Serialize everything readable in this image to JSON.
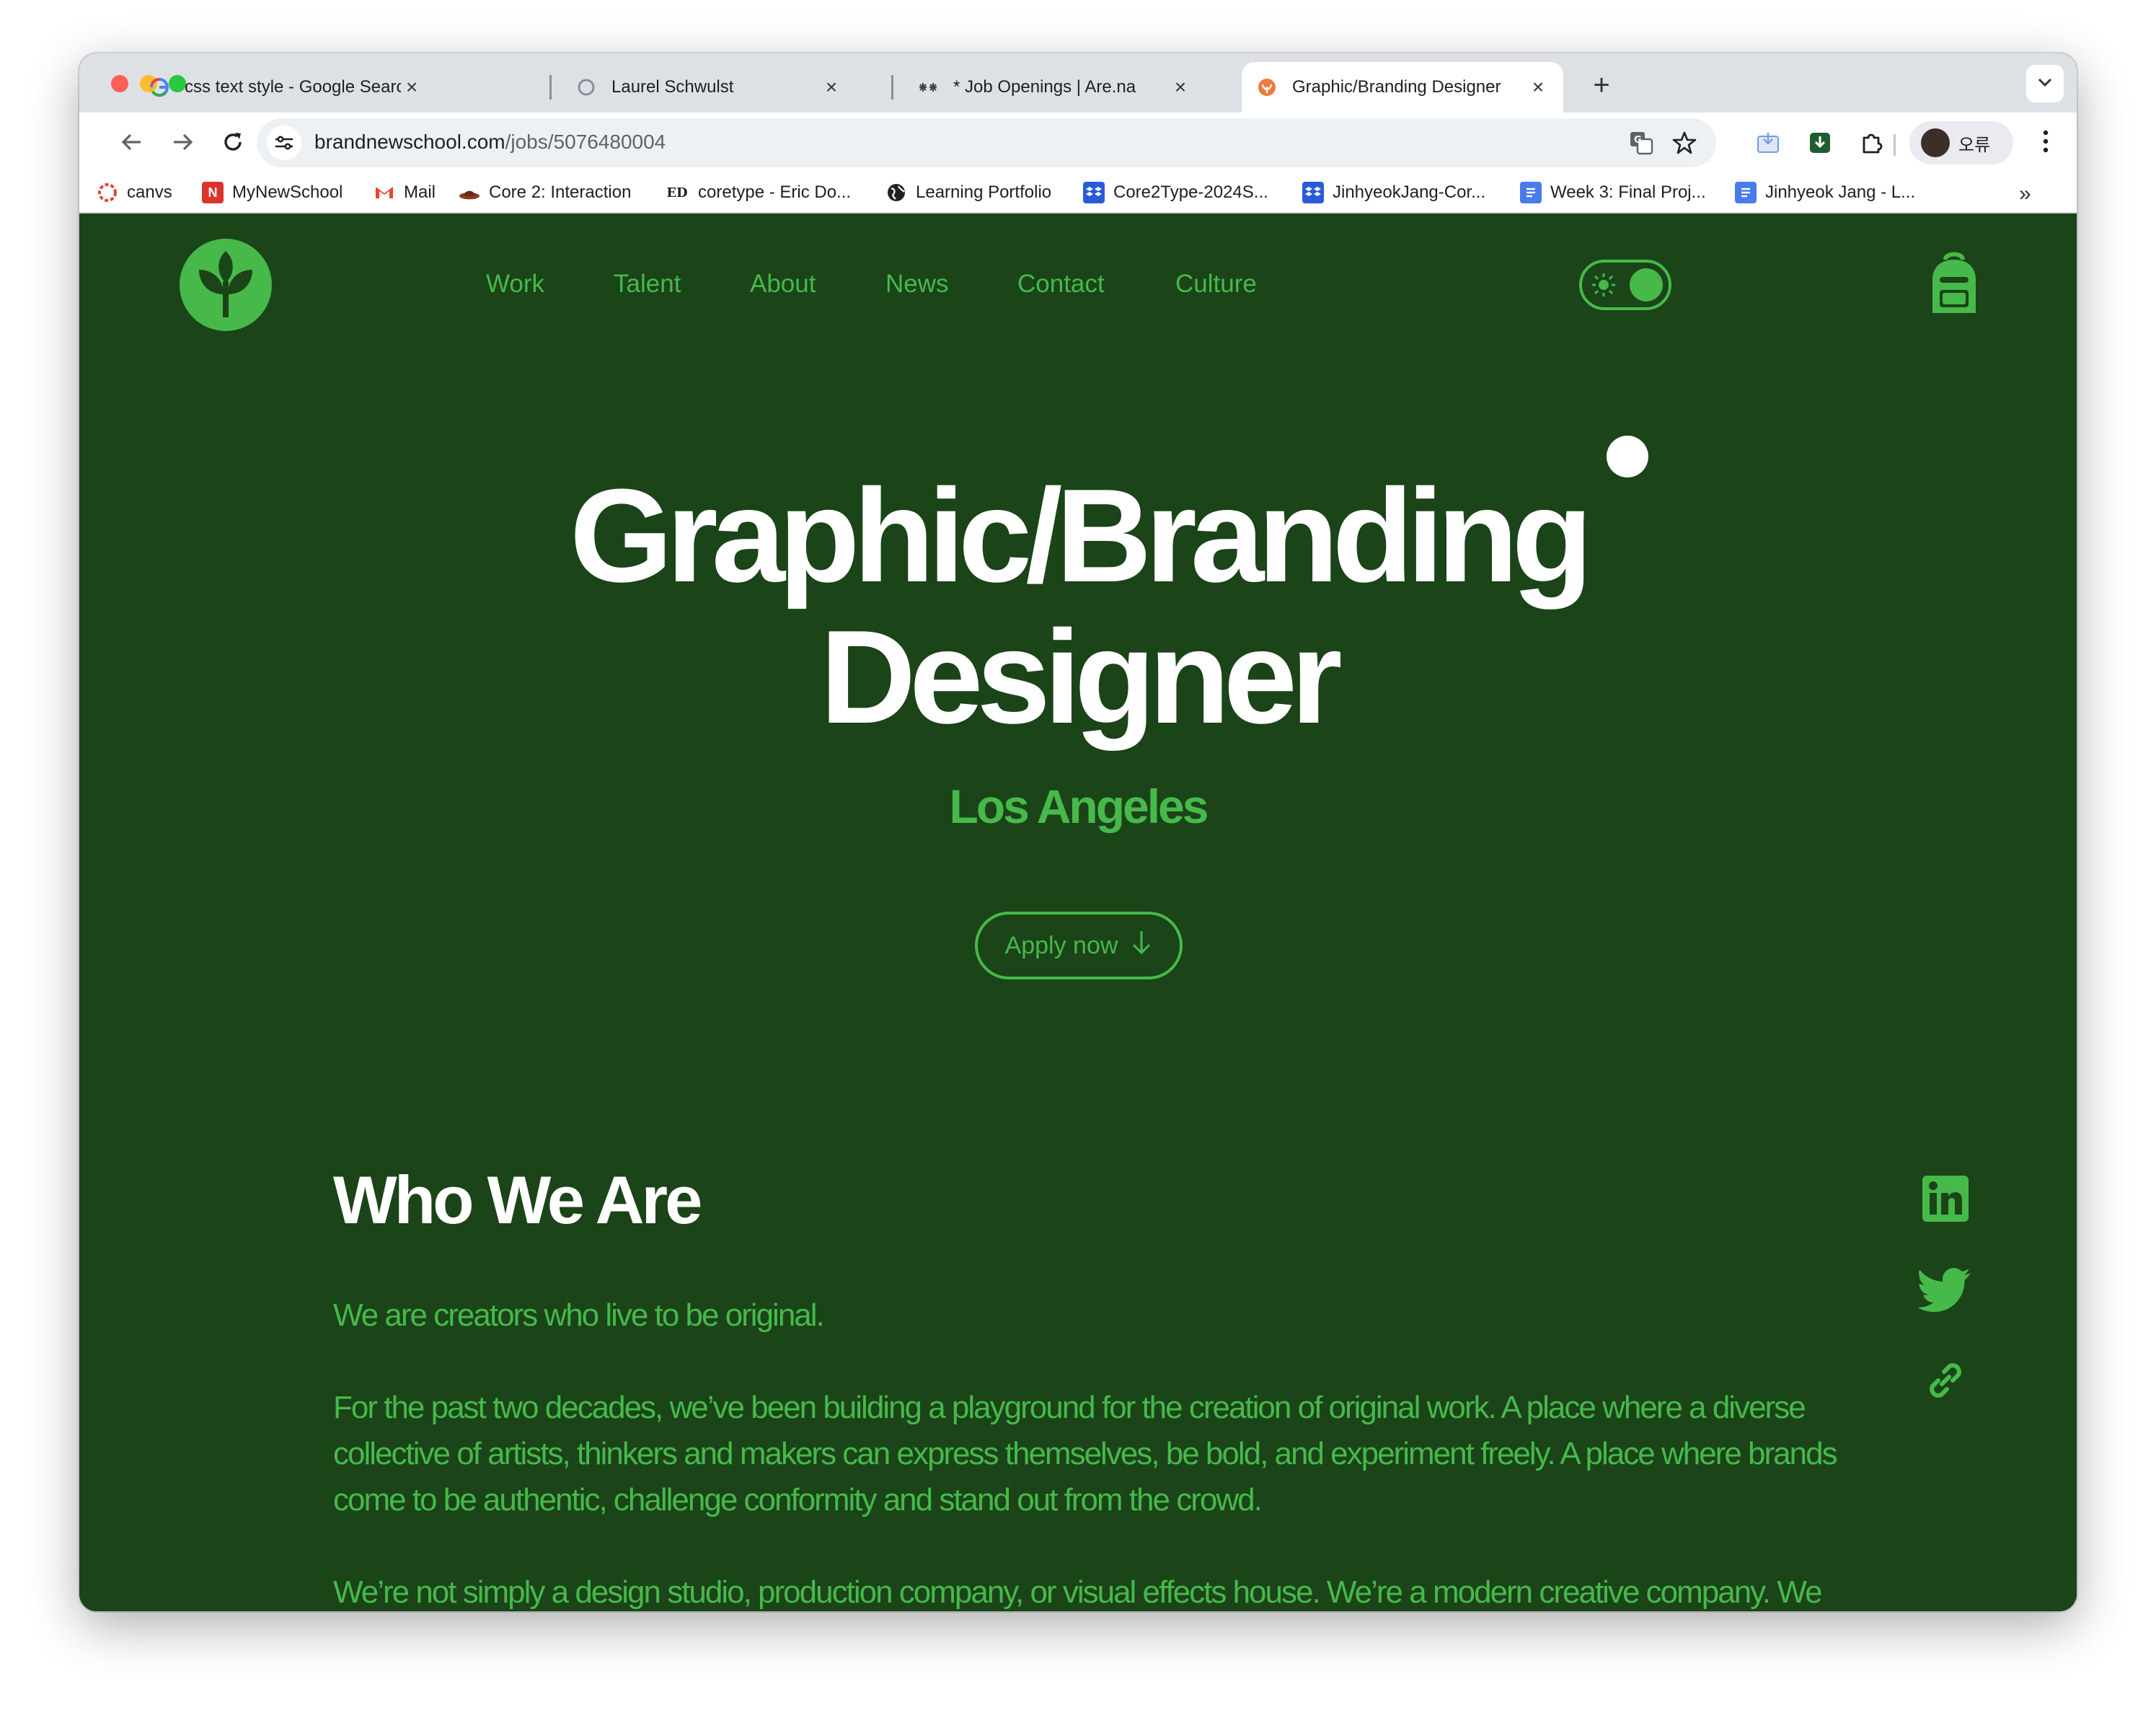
{
  "browser": {
    "tabs": [
      {
        "title": "css text style - Google Search",
        "icon": "google-icon"
      },
      {
        "title": "Laurel Schwulst",
        "icon": "globe-outline-icon"
      },
      {
        "title": "* Job Openings | Are.na",
        "icon": "arena-icon"
      },
      {
        "title": "Graphic/Branding Designer",
        "icon": "bns-favicon-icon",
        "active": true
      }
    ],
    "close_glyph": "×",
    "new_tab_glyph": "+",
    "url_domain": "brandnewschool.com",
    "url_path": "/jobs/5076480004",
    "profile_name": "오류",
    "bookmarks": [
      {
        "label": "canvs",
        "icon": "canvs-icon",
        "color": "#e0443c"
      },
      {
        "label": "MyNewSchool",
        "icon": "mynewschool-icon",
        "color": "#d9342b"
      },
      {
        "label": "Mail",
        "icon": "gmail-icon",
        "color": "#ea4335"
      },
      {
        "label": "Core 2: Interaction",
        "icon": "hat-icon",
        "color": "#8a3a22"
      },
      {
        "label": "coretype - Eric Do...",
        "icon": "ed-icon",
        "color": "#222222"
      },
      {
        "label": "Learning Portfolio",
        "icon": "globe-icon",
        "color": "#222222"
      },
      {
        "label": "Core2Type-2024S...",
        "icon": "dropbox-icon",
        "color": "#2a5bd7"
      },
      {
        "label": "JinhyeokJang-Cor...",
        "icon": "dropbox-icon",
        "color": "#2a5bd7"
      },
      {
        "label": "Week 3: Final Proj...",
        "icon": "docs-icon",
        "color": "#4a7bea"
      },
      {
        "label": "Jinhyeok Jang - L...",
        "icon": "docs-icon",
        "color": "#4a7bea"
      }
    ],
    "bookmarks_overflow": "»"
  },
  "site": {
    "nav": [
      "Work",
      "Talent",
      "About",
      "News",
      "Contact",
      "Culture"
    ],
    "theme_toggle": "on",
    "job_title_line1": "Graphic/Branding",
    "job_title_line2": "Designer",
    "location": "Los Angeles",
    "apply_label": "Apply now",
    "section_title": "Who We Are",
    "paragraphs": [
      "We are creators who live to be original.",
      "For the past two decades, we’ve been building a playground for the creation of original work. A place where a diverse collective of artists, thinkers and makers can express themselves, be bold, and experiment freely. A place where brands come to be authentic, challenge conformity and stand out from the crowd.",
      "We’re not simply a design studio, production company, or visual effects house. We’re a modern creative company. We strategize, we ideate, we design, we create, we make. We go wherever our pursuit of originality"
    ],
    "social": [
      "linkedin-icon",
      "twitter-icon",
      "link-icon"
    ]
  },
  "colors": {
    "page_bg": "#1b4419",
    "accent_green": "#46b94a",
    "heading": "#ffffff"
  }
}
